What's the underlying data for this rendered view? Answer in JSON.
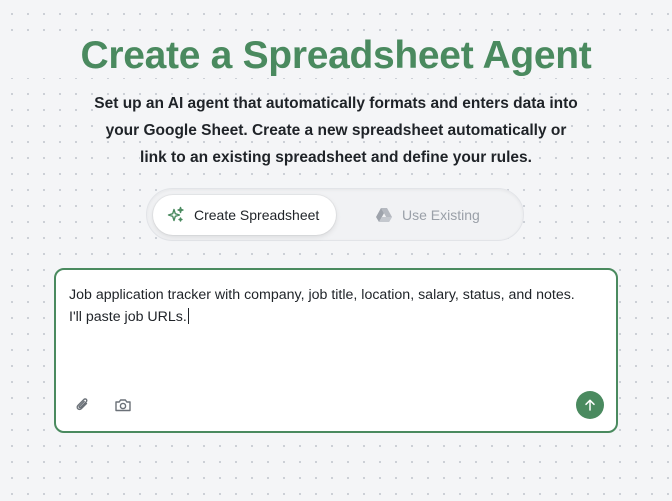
{
  "header": {
    "title": "Create a Spreadsheet Agent",
    "subtitle_lines": [
      "Set up an AI agent that automatically formats and enters data into",
      "your Google Sheet. Create a new spreadsheet automatically or",
      "link to an existing spreadsheet and define your rules."
    ]
  },
  "mode_toggle": {
    "active": "create",
    "create_label": "Create Spreadsheet",
    "create_icon": "sparkle-icon",
    "existing_label": "Use Existing",
    "existing_icon": "google-drive-icon"
  },
  "composer": {
    "value": "Job application tracker with company, job title, location, salary, status, and notes. I'll paste job URLs.",
    "attach_icon": "paperclip-icon",
    "camera_icon": "camera-icon",
    "send_icon": "arrow-up-icon"
  },
  "colors": {
    "accent": "#4a8a5f",
    "text": "#1f2328",
    "muted": "#9aa0a8",
    "background": "#f4f5f7"
  }
}
